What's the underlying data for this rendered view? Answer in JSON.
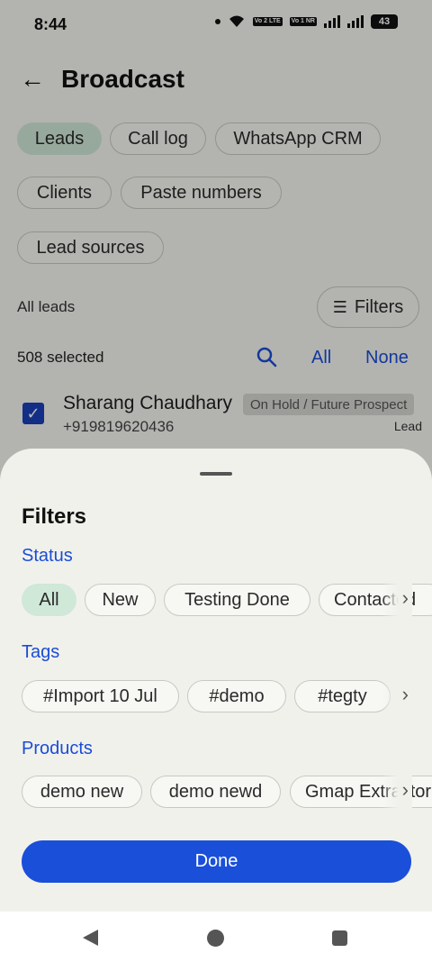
{
  "status_bar": {
    "time": "8:44",
    "tag1": "Vo 2 LTE",
    "tag2": "Vo 1 NR",
    "battery": "43"
  },
  "header": {
    "title": "Broadcast"
  },
  "source_chips": [
    {
      "label": "Leads",
      "selected": true
    },
    {
      "label": "Call log",
      "selected": false
    },
    {
      "label": "WhatsApp CRM",
      "selected": false
    },
    {
      "label": "Clients",
      "selected": false
    },
    {
      "label": "Paste numbers",
      "selected": false
    },
    {
      "label": "Lead sources",
      "selected": false
    }
  ],
  "list": {
    "heading": "All leads",
    "filters_label": "Filters",
    "selected_text": "508 selected",
    "all_label": "All",
    "none_label": "None"
  },
  "lead": {
    "name": "Sharang Chaudhary",
    "phone": "+919819620436",
    "status": "On Hold / Future Prospect",
    "type": "Lead",
    "checked": true
  },
  "sheet": {
    "title": "Filters",
    "status_label": "Status",
    "status_options": [
      "All",
      "New",
      "Testing Done",
      "Contacted"
    ],
    "status_selected": "All",
    "tags_label": "Tags",
    "tag_options": [
      "#Import 10 Jul",
      "#demo",
      "#tegty"
    ],
    "products_label": "Products",
    "product_options": [
      "demo new",
      "demo newd",
      "Gmap Extractor"
    ],
    "done_label": "Done"
  },
  "colors": {
    "accent": "#1a4fd9",
    "selected_chip": "#cfe8d7",
    "section_label": "#1a4dd6"
  }
}
